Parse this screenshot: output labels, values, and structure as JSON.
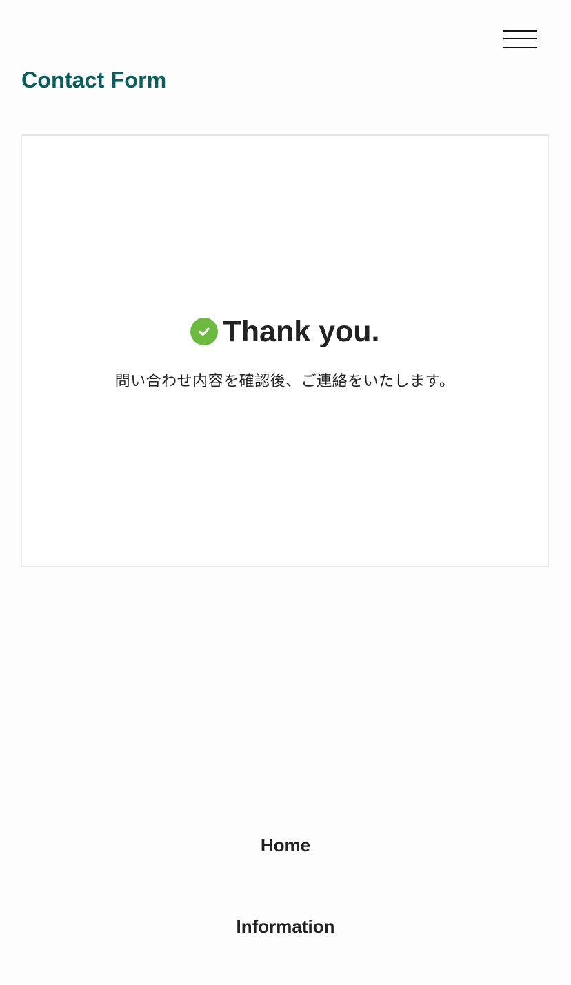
{
  "header": {
    "menu_icon": "hamburger-menu-icon",
    "page_title": "Contact Form"
  },
  "result": {
    "status_icon": "check-circle-icon",
    "heading": "Thank you.",
    "message": "問い合わせ内容を確認後、ご連絡をいたします。"
  },
  "footer": {
    "links": [
      {
        "label": "Home"
      },
      {
        "label": "Information"
      }
    ]
  },
  "colors": {
    "title": "#0b5e5b",
    "success": "#6cb93f",
    "text": "#222222",
    "border": "#e6e6e6"
  }
}
